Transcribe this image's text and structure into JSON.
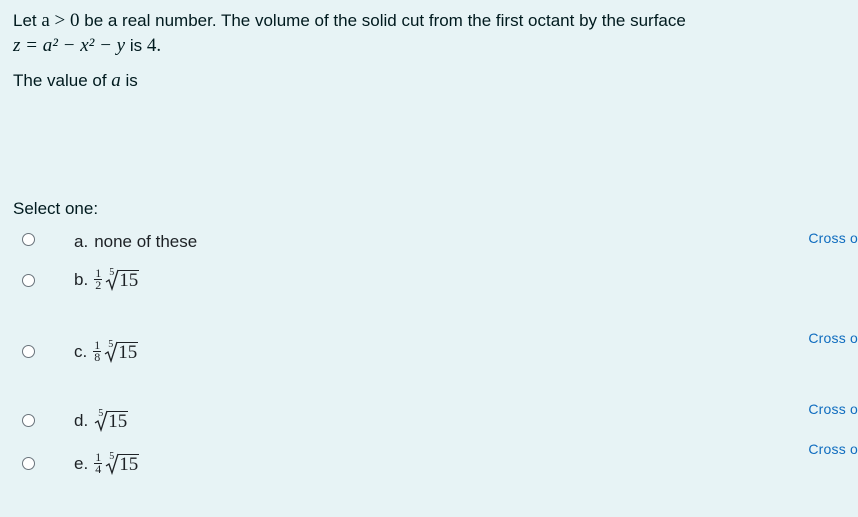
{
  "question": {
    "line1_prefix": "Let ",
    "line1_math": "a > 0",
    "line1_suffix": " be a real number. The volume of the solid cut from the first octant by the surface",
    "line2_math": "z = a² − x² − y",
    "line2_is": " is ",
    "line2_value": "4.",
    "line3_prefix": "The value of ",
    "line3_var": "a",
    "line3_suffix": " is"
  },
  "prompt": "Select one:",
  "options": [
    {
      "letter": "a.",
      "text": "none of these",
      "cross_label": "Cross o"
    },
    {
      "letter": "b.",
      "frac_num": "1",
      "frac_den": "2",
      "root_index": "5",
      "radicand": "15",
      "cross_label": ""
    },
    {
      "letter": "c.",
      "frac_num": "1",
      "frac_den": "8",
      "root_index": "5",
      "radicand": "15",
      "cross_label": "Cross o"
    },
    {
      "letter": "d.",
      "root_index": "5",
      "radicand": "15",
      "cross_label": "Cross o"
    },
    {
      "letter": "e.",
      "frac_num": "1",
      "frac_den": "4",
      "root_index": "5",
      "radicand": "15",
      "cross_label": "Cross o"
    }
  ],
  "colors": {
    "background": "#e7f3f5",
    "link": "#0f6cbf",
    "text": "#1d2125"
  }
}
